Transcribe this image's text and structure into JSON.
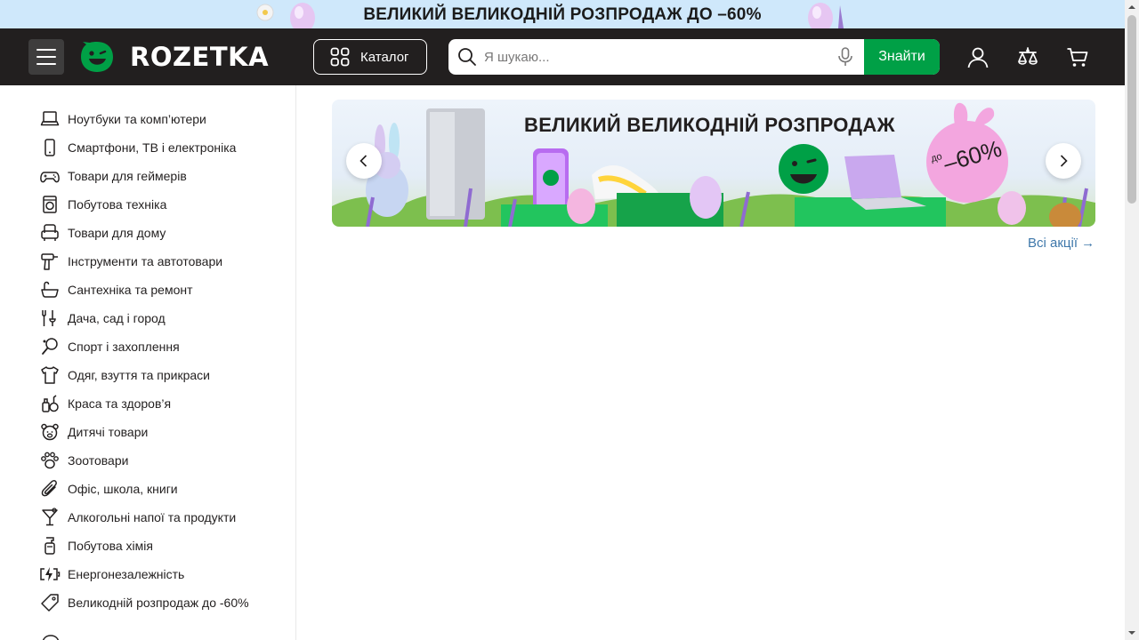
{
  "promo_strip": {
    "text": "ВЕЛИКИЙ ВЕЛИКОДНІЙ РОЗПРОДАЖ ДО –60%",
    "bg_color": "#cfe8fb"
  },
  "header": {
    "bg_color": "#221f1f",
    "menu_icon": "hamburger-icon",
    "logo_text": "ROZETKA",
    "catalog_label": "Каталог",
    "search_placeholder": "Я шукаю...",
    "search_button": "Знайти",
    "accent_color": "#00a046",
    "icons": [
      "user-icon",
      "compare-icon",
      "cart-icon"
    ]
  },
  "sidebar": {
    "items": [
      {
        "label": "Ноутбуки та комп’ютери",
        "icon": "laptop-icon"
      },
      {
        "label": "Смартфони, ТВ і електроніка",
        "icon": "smartphone-icon"
      },
      {
        "label": "Товари для геймерів",
        "icon": "gamepad-icon"
      },
      {
        "label": "Побутова техніка",
        "icon": "washing-machine-icon"
      },
      {
        "label": "Товари для дому",
        "icon": "armchair-icon"
      },
      {
        "label": "Інструменти та автотовари",
        "icon": "drill-icon"
      },
      {
        "label": "Сантехніка та ремонт",
        "icon": "bathtub-icon"
      },
      {
        "label": "Дача, сад і город",
        "icon": "garden-tools-icon"
      },
      {
        "label": "Спорт і захоплення",
        "icon": "racket-icon"
      },
      {
        "label": "Одяг, взуття та прикраси",
        "icon": "tshirt-icon"
      },
      {
        "label": "Краса та здоров’я",
        "icon": "cosmetics-icon"
      },
      {
        "label": "Дитячі товари",
        "icon": "teddy-bear-icon"
      },
      {
        "label": "Зоотовари",
        "icon": "paw-icon"
      },
      {
        "label": "Офіс, школа, книги",
        "icon": "paperclip-icon"
      },
      {
        "label": "Алкогольні напої та продукти",
        "icon": "cocktail-icon"
      },
      {
        "label": "Побутова хімія",
        "icon": "detergent-icon"
      },
      {
        "label": "Енергонезалежність",
        "icon": "battery-bolt-icon"
      },
      {
        "label": "Великодній розпродаж до -60%",
        "icon": "tag-icon"
      }
    ]
  },
  "banner": {
    "title": "ВЕЛИКИЙ ВЕЛИКОДНІЙ РОЗПРОДАЖ",
    "badge_prefix": "до",
    "badge_value": "–60%"
  },
  "all_promos_link": "Всі акції →"
}
